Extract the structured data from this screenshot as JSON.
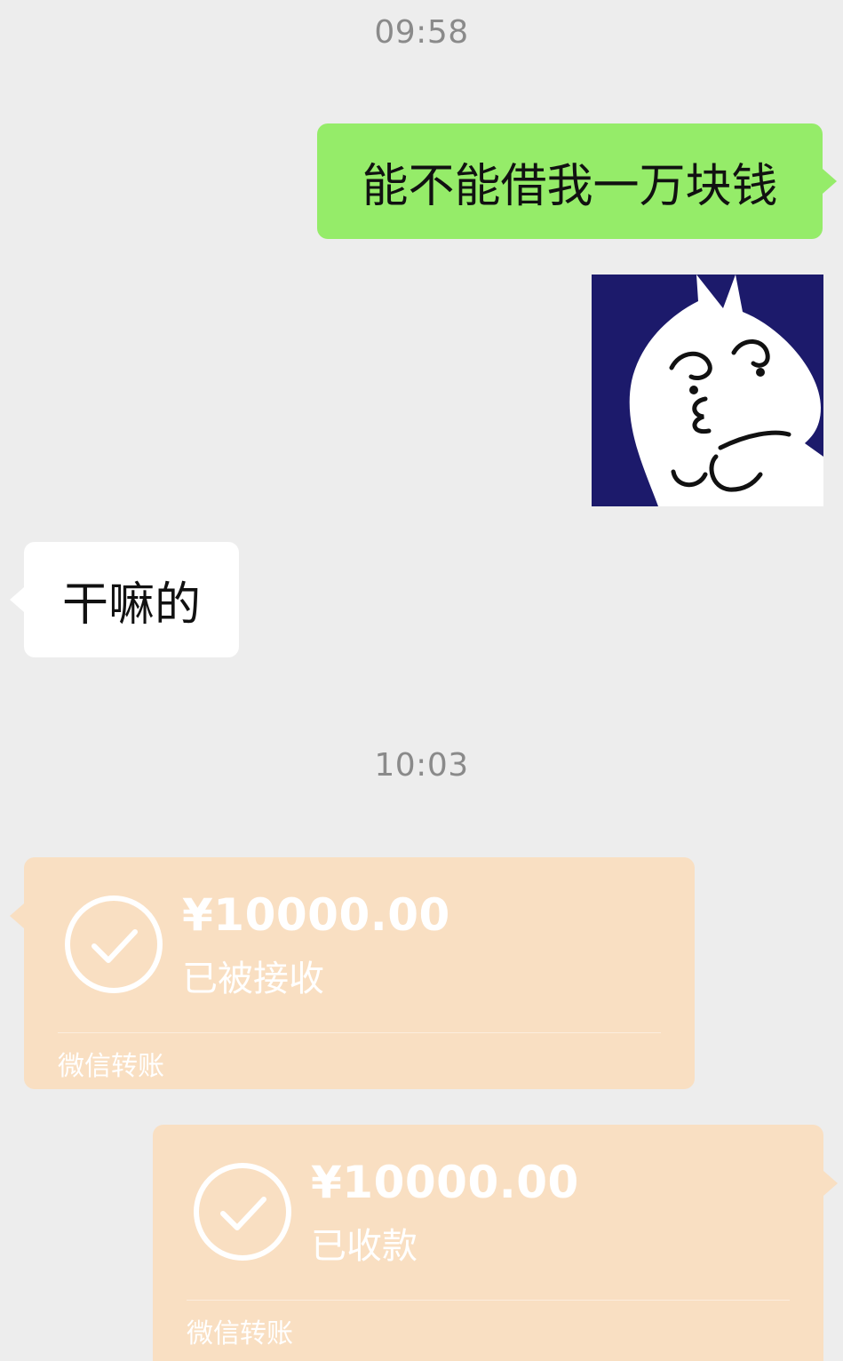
{
  "chat": {
    "timestamps": [
      "09:58",
      "10:03"
    ],
    "messages": {
      "outgoing_request": "能不能借我一万块钱",
      "outgoing_sticker": {
        "icon": "cute-cat-sticker-icon",
        "background": "#1c1a6b"
      },
      "incoming_reply": "干嘛的",
      "incoming_transfer": {
        "amount": "¥10000.00",
        "status": "已被接收",
        "label": "微信转账"
      },
      "outgoing_transfer": {
        "amount": "¥10000.00",
        "status": "已收款",
        "label": "微信转账"
      }
    }
  },
  "colors": {
    "background": "#ededed",
    "outgoing_bubble": "#95ec69",
    "incoming_bubble": "#ffffff",
    "transfer_card": "#f9dfc2",
    "timestamp_text": "#8a8a8a"
  }
}
